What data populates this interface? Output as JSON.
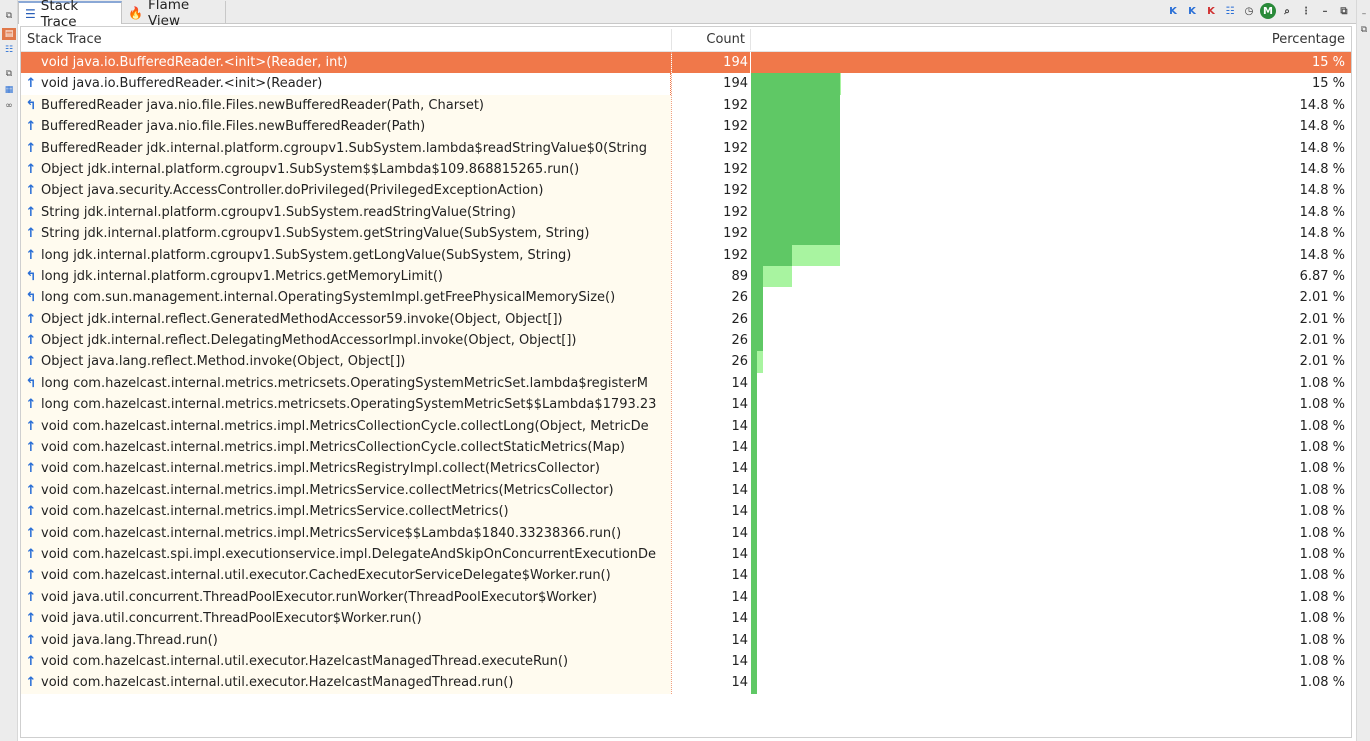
{
  "tabs": [
    {
      "label": "Stack Trace",
      "icon": "list-icon",
      "active": true
    },
    {
      "label": "Flame View",
      "icon": "flame-icon",
      "active": false
    }
  ],
  "columns": {
    "name": "Stack Trace",
    "count": "Count",
    "percentage": "Percentage"
  },
  "colors": {
    "selected": "#f0784a",
    "bar_dark": "#5fc865",
    "bar_light": "#a8f4a0",
    "name_bg": "#fffbef"
  },
  "rows": [
    {
      "name": "void java.io.BufferedReader.<init>(Reader, int)",
      "count": "194",
      "pct": "15 %",
      "frac": 0.15,
      "icon": "none"
    },
    {
      "name": "void java.io.BufferedReader.<init>(Reader)",
      "count": "194",
      "pct": "15 %",
      "frac": 0.15,
      "icon": "up-arrow"
    },
    {
      "name": "BufferedReader java.nio.file.Files.newBufferedReader(Path, Charset)",
      "count": "192",
      "pct": "14.8 %",
      "frac": 0.148,
      "icon": "branch-up"
    },
    {
      "name": "BufferedReader java.nio.file.Files.newBufferedReader(Path)",
      "count": "192",
      "pct": "14.8 %",
      "frac": 0.148,
      "icon": "up-arrow"
    },
    {
      "name": "BufferedReader jdk.internal.platform.cgroupv1.SubSystem.lambda$readStringValue$0(String",
      "count": "192",
      "pct": "14.8 %",
      "frac": 0.148,
      "icon": "up-arrow"
    },
    {
      "name": "Object jdk.internal.platform.cgroupv1.SubSystem$$Lambda$109.868815265.run()",
      "count": "192",
      "pct": "14.8 %",
      "frac": 0.148,
      "icon": "up-arrow"
    },
    {
      "name": "Object java.security.AccessController.doPrivileged(PrivilegedExceptionAction)",
      "count": "192",
      "pct": "14.8 %",
      "frac": 0.148,
      "icon": "up-arrow"
    },
    {
      "name": "String jdk.internal.platform.cgroupv1.SubSystem.readStringValue(String)",
      "count": "192",
      "pct": "14.8 %",
      "frac": 0.148,
      "icon": "up-arrow"
    },
    {
      "name": "String jdk.internal.platform.cgroupv1.SubSystem.getStringValue(SubSystem, String)",
      "count": "192",
      "pct": "14.8 %",
      "frac": 0.148,
      "icon": "up-arrow"
    },
    {
      "name": "long jdk.internal.platform.cgroupv1.SubSystem.getLongValue(SubSystem, String)",
      "count": "192",
      "pct": "14.8 %",
      "frac": 0.148,
      "icon": "up-arrow"
    },
    {
      "name": "long jdk.internal.platform.cgroupv1.Metrics.getMemoryLimit()",
      "count": "89",
      "pct": "6.87 %",
      "frac": 0.0687,
      "icon": "branch-up"
    },
    {
      "name": "long com.sun.management.internal.OperatingSystemImpl.getFreePhysicalMemorySize()",
      "count": "26",
      "pct": "2.01 %",
      "frac": 0.0201,
      "icon": "branch-up"
    },
    {
      "name": "Object jdk.internal.reflect.GeneratedMethodAccessor59.invoke(Object, Object[])",
      "count": "26",
      "pct": "2.01 %",
      "frac": 0.0201,
      "icon": "up-arrow"
    },
    {
      "name": "Object jdk.internal.reflect.DelegatingMethodAccessorImpl.invoke(Object, Object[])",
      "count": "26",
      "pct": "2.01 %",
      "frac": 0.0201,
      "icon": "up-arrow"
    },
    {
      "name": "Object java.lang.reflect.Method.invoke(Object, Object[])",
      "count": "26",
      "pct": "2.01 %",
      "frac": 0.0201,
      "icon": "up-arrow"
    },
    {
      "name": "long com.hazelcast.internal.metrics.metricsets.OperatingSystemMetricSet.lambda$registerM",
      "count": "14",
      "pct": "1.08 %",
      "frac": 0.0108,
      "icon": "branch-up"
    },
    {
      "name": "long com.hazelcast.internal.metrics.metricsets.OperatingSystemMetricSet$$Lambda$1793.23",
      "count": "14",
      "pct": "1.08 %",
      "frac": 0.0108,
      "icon": "up-arrow"
    },
    {
      "name": "void com.hazelcast.internal.metrics.impl.MetricsCollectionCycle.collectLong(Object, MetricDe",
      "count": "14",
      "pct": "1.08 %",
      "frac": 0.0108,
      "icon": "up-arrow"
    },
    {
      "name": "void com.hazelcast.internal.metrics.impl.MetricsCollectionCycle.collectStaticMetrics(Map)",
      "count": "14",
      "pct": "1.08 %",
      "frac": 0.0108,
      "icon": "up-arrow"
    },
    {
      "name": "void com.hazelcast.internal.metrics.impl.MetricsRegistryImpl.collect(MetricsCollector)",
      "count": "14",
      "pct": "1.08 %",
      "frac": 0.0108,
      "icon": "up-arrow"
    },
    {
      "name": "void com.hazelcast.internal.metrics.impl.MetricsService.collectMetrics(MetricsCollector)",
      "count": "14",
      "pct": "1.08 %",
      "frac": 0.0108,
      "icon": "up-arrow"
    },
    {
      "name": "void com.hazelcast.internal.metrics.impl.MetricsService.collectMetrics()",
      "count": "14",
      "pct": "1.08 %",
      "frac": 0.0108,
      "icon": "up-arrow"
    },
    {
      "name": "void com.hazelcast.internal.metrics.impl.MetricsService$$Lambda$1840.33238366.run()",
      "count": "14",
      "pct": "1.08 %",
      "frac": 0.0108,
      "icon": "up-arrow"
    },
    {
      "name": "void com.hazelcast.spi.impl.executionservice.impl.DelegateAndSkipOnConcurrentExecutionDe",
      "count": "14",
      "pct": "1.08 %",
      "frac": 0.0108,
      "icon": "up-arrow"
    },
    {
      "name": "void com.hazelcast.internal.util.executor.CachedExecutorServiceDelegate$Worker.run()",
      "count": "14",
      "pct": "1.08 %",
      "frac": 0.0108,
      "icon": "up-arrow"
    },
    {
      "name": "void java.util.concurrent.ThreadPoolExecutor.runWorker(ThreadPoolExecutor$Worker)",
      "count": "14",
      "pct": "1.08 %",
      "frac": 0.0108,
      "icon": "up-arrow"
    },
    {
      "name": "void java.util.concurrent.ThreadPoolExecutor$Worker.run()",
      "count": "14",
      "pct": "1.08 %",
      "frac": 0.0108,
      "icon": "up-arrow"
    },
    {
      "name": "void java.lang.Thread.run()",
      "count": "14",
      "pct": "1.08 %",
      "frac": 0.0108,
      "icon": "up-arrow"
    },
    {
      "name": "void com.hazelcast.internal.util.executor.HazelcastManagedThread.executeRun()",
      "count": "14",
      "pct": "1.08 %",
      "frac": 0.0108,
      "icon": "up-arrow"
    },
    {
      "name": "void com.hazelcast.internal.util.executor.HazelcastManagedThread.run()",
      "count": "14",
      "pct": "1.08 %",
      "frac": 0.0108,
      "icon": "up-arrow"
    }
  ]
}
